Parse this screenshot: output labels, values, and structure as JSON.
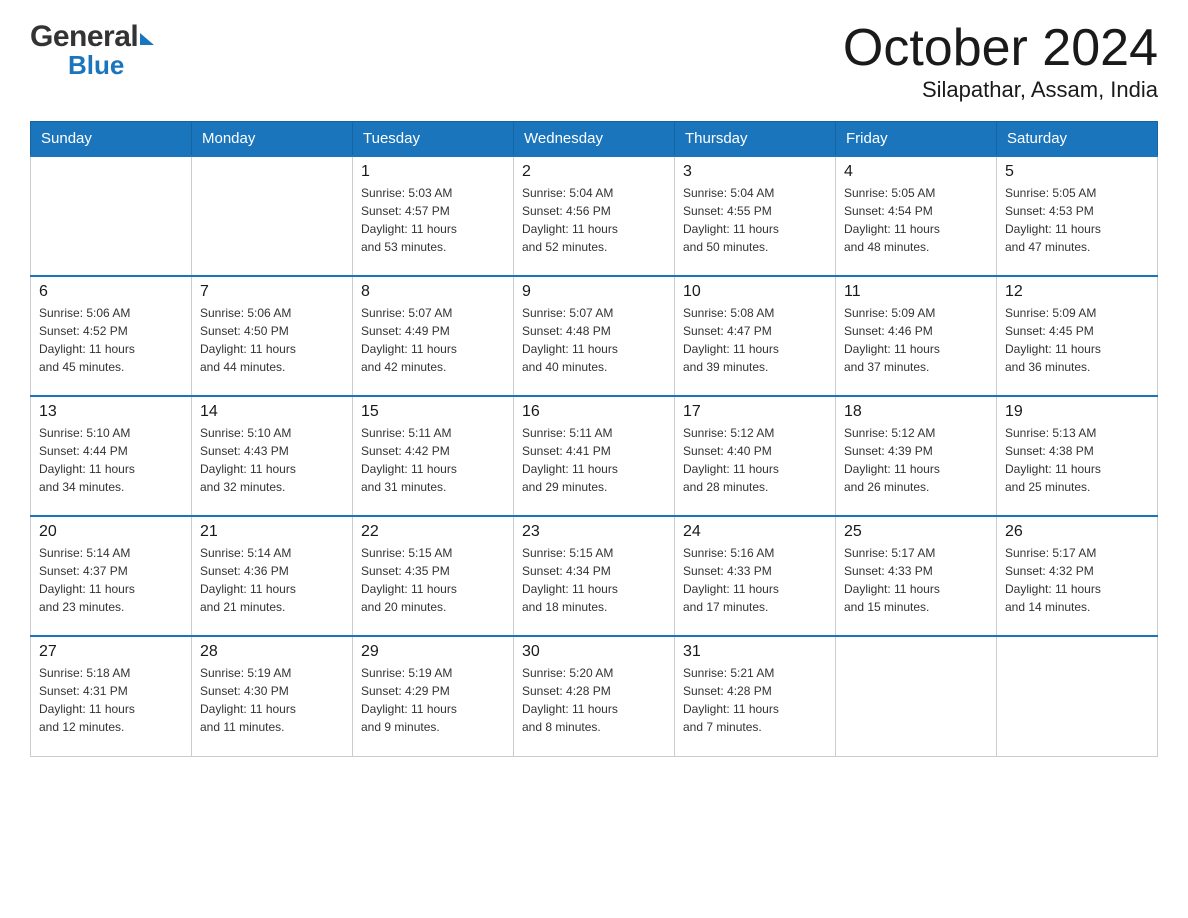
{
  "header": {
    "title": "October 2024",
    "subtitle": "Silapathar, Assam, India",
    "logo_general": "General",
    "logo_blue": "Blue"
  },
  "weekdays": [
    "Sunday",
    "Monday",
    "Tuesday",
    "Wednesday",
    "Thursday",
    "Friday",
    "Saturday"
  ],
  "weeks": [
    [
      {
        "day": "",
        "info": ""
      },
      {
        "day": "",
        "info": ""
      },
      {
        "day": "1",
        "info": "Sunrise: 5:03 AM\nSunset: 4:57 PM\nDaylight: 11 hours\nand 53 minutes."
      },
      {
        "day": "2",
        "info": "Sunrise: 5:04 AM\nSunset: 4:56 PM\nDaylight: 11 hours\nand 52 minutes."
      },
      {
        "day": "3",
        "info": "Sunrise: 5:04 AM\nSunset: 4:55 PM\nDaylight: 11 hours\nand 50 minutes."
      },
      {
        "day": "4",
        "info": "Sunrise: 5:05 AM\nSunset: 4:54 PM\nDaylight: 11 hours\nand 48 minutes."
      },
      {
        "day": "5",
        "info": "Sunrise: 5:05 AM\nSunset: 4:53 PM\nDaylight: 11 hours\nand 47 minutes."
      }
    ],
    [
      {
        "day": "6",
        "info": "Sunrise: 5:06 AM\nSunset: 4:52 PM\nDaylight: 11 hours\nand 45 minutes."
      },
      {
        "day": "7",
        "info": "Sunrise: 5:06 AM\nSunset: 4:50 PM\nDaylight: 11 hours\nand 44 minutes."
      },
      {
        "day": "8",
        "info": "Sunrise: 5:07 AM\nSunset: 4:49 PM\nDaylight: 11 hours\nand 42 minutes."
      },
      {
        "day": "9",
        "info": "Sunrise: 5:07 AM\nSunset: 4:48 PM\nDaylight: 11 hours\nand 40 minutes."
      },
      {
        "day": "10",
        "info": "Sunrise: 5:08 AM\nSunset: 4:47 PM\nDaylight: 11 hours\nand 39 minutes."
      },
      {
        "day": "11",
        "info": "Sunrise: 5:09 AM\nSunset: 4:46 PM\nDaylight: 11 hours\nand 37 minutes."
      },
      {
        "day": "12",
        "info": "Sunrise: 5:09 AM\nSunset: 4:45 PM\nDaylight: 11 hours\nand 36 minutes."
      }
    ],
    [
      {
        "day": "13",
        "info": "Sunrise: 5:10 AM\nSunset: 4:44 PM\nDaylight: 11 hours\nand 34 minutes."
      },
      {
        "day": "14",
        "info": "Sunrise: 5:10 AM\nSunset: 4:43 PM\nDaylight: 11 hours\nand 32 minutes."
      },
      {
        "day": "15",
        "info": "Sunrise: 5:11 AM\nSunset: 4:42 PM\nDaylight: 11 hours\nand 31 minutes."
      },
      {
        "day": "16",
        "info": "Sunrise: 5:11 AM\nSunset: 4:41 PM\nDaylight: 11 hours\nand 29 minutes."
      },
      {
        "day": "17",
        "info": "Sunrise: 5:12 AM\nSunset: 4:40 PM\nDaylight: 11 hours\nand 28 minutes."
      },
      {
        "day": "18",
        "info": "Sunrise: 5:12 AM\nSunset: 4:39 PM\nDaylight: 11 hours\nand 26 minutes."
      },
      {
        "day": "19",
        "info": "Sunrise: 5:13 AM\nSunset: 4:38 PM\nDaylight: 11 hours\nand 25 minutes."
      }
    ],
    [
      {
        "day": "20",
        "info": "Sunrise: 5:14 AM\nSunset: 4:37 PM\nDaylight: 11 hours\nand 23 minutes."
      },
      {
        "day": "21",
        "info": "Sunrise: 5:14 AM\nSunset: 4:36 PM\nDaylight: 11 hours\nand 21 minutes."
      },
      {
        "day": "22",
        "info": "Sunrise: 5:15 AM\nSunset: 4:35 PM\nDaylight: 11 hours\nand 20 minutes."
      },
      {
        "day": "23",
        "info": "Sunrise: 5:15 AM\nSunset: 4:34 PM\nDaylight: 11 hours\nand 18 minutes."
      },
      {
        "day": "24",
        "info": "Sunrise: 5:16 AM\nSunset: 4:33 PM\nDaylight: 11 hours\nand 17 minutes."
      },
      {
        "day": "25",
        "info": "Sunrise: 5:17 AM\nSunset: 4:33 PM\nDaylight: 11 hours\nand 15 minutes."
      },
      {
        "day": "26",
        "info": "Sunrise: 5:17 AM\nSunset: 4:32 PM\nDaylight: 11 hours\nand 14 minutes."
      }
    ],
    [
      {
        "day": "27",
        "info": "Sunrise: 5:18 AM\nSunset: 4:31 PM\nDaylight: 11 hours\nand 12 minutes."
      },
      {
        "day": "28",
        "info": "Sunrise: 5:19 AM\nSunset: 4:30 PM\nDaylight: 11 hours\nand 11 minutes."
      },
      {
        "day": "29",
        "info": "Sunrise: 5:19 AM\nSunset: 4:29 PM\nDaylight: 11 hours\nand 9 minutes."
      },
      {
        "day": "30",
        "info": "Sunrise: 5:20 AM\nSunset: 4:28 PM\nDaylight: 11 hours\nand 8 minutes."
      },
      {
        "day": "31",
        "info": "Sunrise: 5:21 AM\nSunset: 4:28 PM\nDaylight: 11 hours\nand 7 minutes."
      },
      {
        "day": "",
        "info": ""
      },
      {
        "day": "",
        "info": ""
      }
    ]
  ]
}
